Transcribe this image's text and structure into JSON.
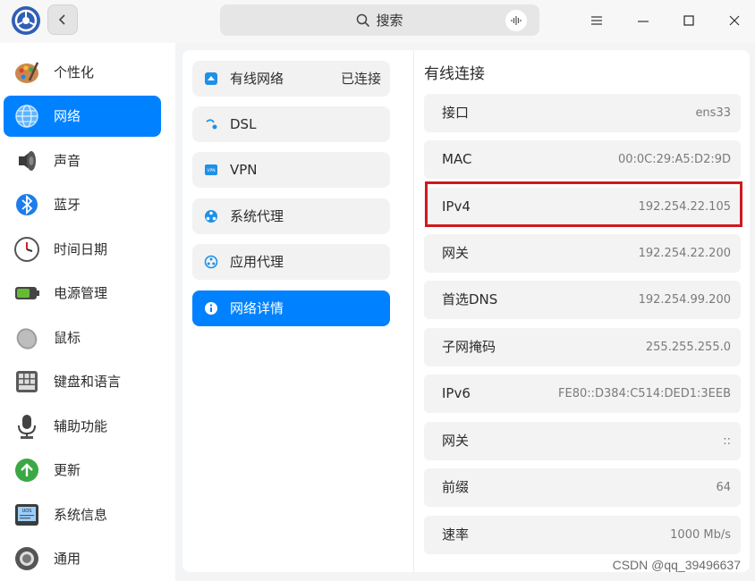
{
  "titlebar": {
    "search_placeholder": "搜索"
  },
  "sidebar": {
    "items": [
      {
        "label": "个性化",
        "icon": "palette-icon"
      },
      {
        "label": "网络",
        "icon": "network-globe-icon",
        "active": true
      },
      {
        "label": "声音",
        "icon": "speaker-icon"
      },
      {
        "label": "蓝牙",
        "icon": "bluetooth-icon"
      },
      {
        "label": "时间日期",
        "icon": "clock-icon"
      },
      {
        "label": "电源管理",
        "icon": "battery-icon"
      },
      {
        "label": "鼠标",
        "icon": "mouse-icon"
      },
      {
        "label": "键盘和语言",
        "icon": "keyboard-icon"
      },
      {
        "label": "辅助功能",
        "icon": "microphone-icon"
      },
      {
        "label": "更新",
        "icon": "update-arrow-icon"
      },
      {
        "label": "系统信息",
        "icon": "uos-monitor-icon"
      },
      {
        "label": "通用",
        "icon": "general-circle-icon"
      }
    ]
  },
  "network_menu": {
    "items": [
      {
        "label": "有线网络",
        "status": "已连接",
        "icon": "wired-network-icon"
      },
      {
        "label": "DSL",
        "status": "",
        "icon": "dsl-icon"
      },
      {
        "label": "VPN",
        "status": "",
        "icon": "vpn-icon"
      },
      {
        "label": "系统代理",
        "status": "",
        "icon": "system-proxy-icon"
      },
      {
        "label": "应用代理",
        "status": "",
        "icon": "app-proxy-icon"
      },
      {
        "label": "网络详情",
        "status": "",
        "icon": "info-icon",
        "active": true
      }
    ]
  },
  "details": {
    "title": "有线连接",
    "rows": [
      {
        "label": "接口",
        "value": "ens33"
      },
      {
        "label": "MAC",
        "value": "00:0C:29:A5:D2:9D"
      },
      {
        "label": "IPv4",
        "value": "192.254.22.105"
      },
      {
        "label": "网关",
        "value": "192.254.22.200"
      },
      {
        "label": "首选DNS",
        "value": "192.254.99.200"
      },
      {
        "label": "子网掩码",
        "value": "255.255.255.0"
      },
      {
        "label": "IPv6",
        "value": "FE80::D384:C514:DED1:3EEB"
      },
      {
        "label": "网关",
        "value": "::"
      },
      {
        "label": "前缀",
        "value": "64"
      },
      {
        "label": "速率",
        "value": "1000 Mb/s"
      }
    ]
  },
  "watermark": "CSDN @qq_39496637",
  "colors": {
    "accent": "#0081ff",
    "highlight": "#d0191f"
  }
}
